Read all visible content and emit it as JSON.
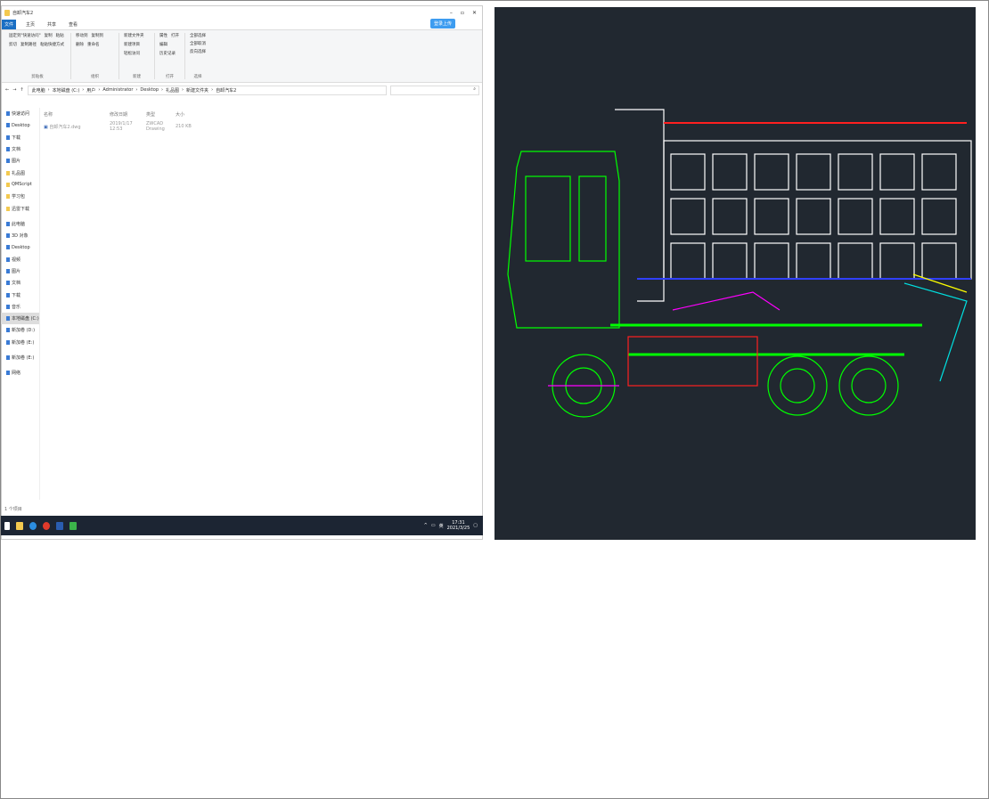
{
  "window": {
    "title": "自卸汽车2",
    "controls": {
      "minimize": "–",
      "maximize": "▫",
      "close": "✕"
    }
  },
  "tabs": [
    "文件",
    "主页",
    "共享",
    "查看"
  ],
  "upload_button": "登录上传",
  "ribbon": {
    "groups": [
      {
        "label": "剪贴板",
        "items": [
          "固定到\"快速访问\"",
          "复制",
          "粘贴",
          "剪切",
          "复制路径",
          "粘贴快捷方式"
        ]
      },
      {
        "label": "组织",
        "items": [
          "移动到",
          "复制到",
          "删除",
          "重命名"
        ]
      },
      {
        "label": "新建",
        "items": [
          "新建文件夹",
          "新建项目",
          "轻松访问"
        ]
      },
      {
        "label": "打开",
        "items": [
          "属性",
          "打开",
          "编辑",
          "历史记录"
        ]
      },
      {
        "label": "选择",
        "items": [
          "全部选择",
          "全部取消",
          "反向选择"
        ]
      }
    ]
  },
  "breadcrumb": [
    "此电脑",
    "本地磁盘 (C:)",
    "用户",
    "Administrator",
    "Desktop",
    "礼品图",
    "新建文件夹",
    "自卸汽车2"
  ],
  "sidebar": [
    "快速访问",
    "Desktop",
    "下载",
    "文档",
    "图片",
    "礼品图",
    "QMScript",
    "学习包",
    "迅雷下载",
    "此电脑",
    "3D 对象",
    "Desktop",
    "视频",
    "图片",
    "文档",
    "下载",
    "音乐",
    "本地磁盘 (C:)",
    "新加卷 (D:)",
    "新加卷 (E:)",
    "新加卷 (E:)",
    "网络"
  ],
  "columns": [
    "名称",
    "修改日期",
    "类型",
    "大小"
  ],
  "files": [
    {
      "name": "自卸汽车2.dwg",
      "date": "2019/1/17 12:53",
      "type": "ZWCAD Drawing",
      "size": "210 KB"
    }
  ],
  "status": "1 个项目",
  "taskbar": {
    "time": "17:31",
    "date": "2021/3/25",
    "ime": "英"
  },
  "colors": {
    "accent": "#1a6fc4",
    "taskbar": "#1c2533",
    "cad_bg": "#212830"
  }
}
